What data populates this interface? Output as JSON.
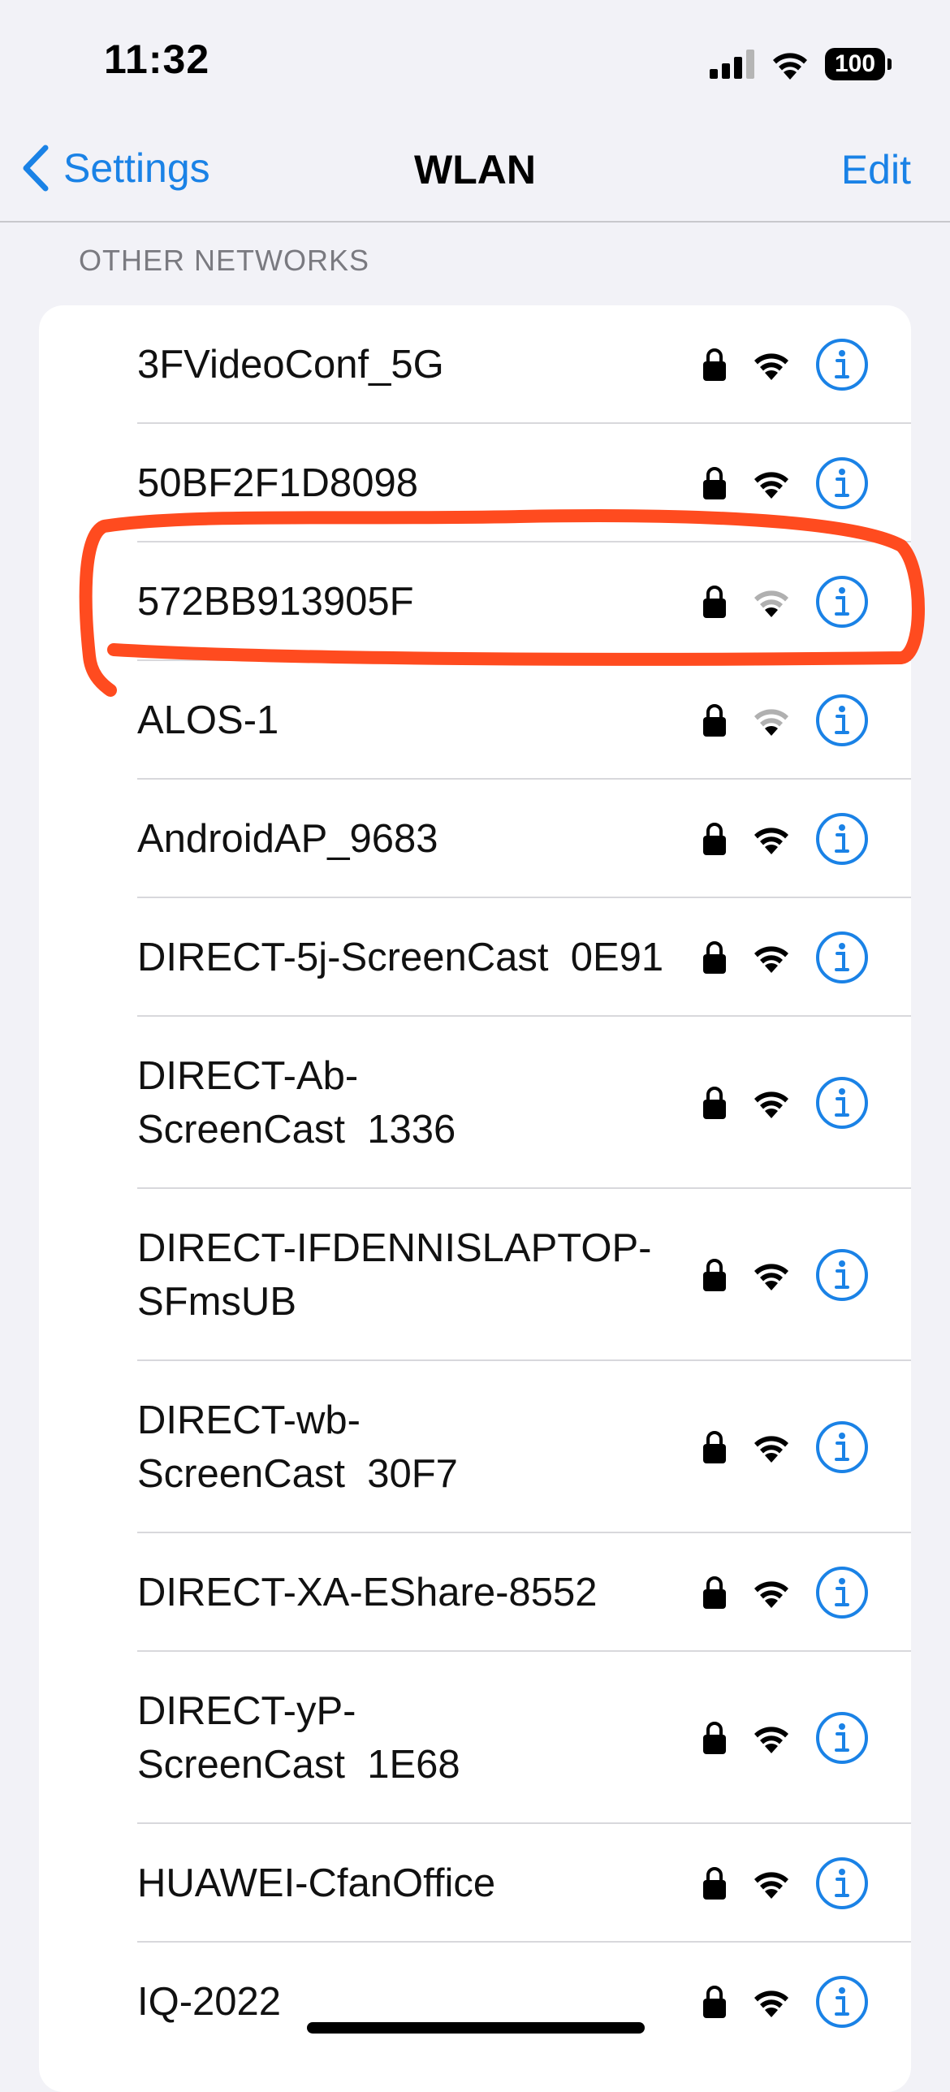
{
  "status_bar": {
    "time": "11:32",
    "battery": "100"
  },
  "nav": {
    "back_label": "Settings",
    "title": "WLAN",
    "edit_label": "Edit"
  },
  "section": {
    "header": "OTHER NETWORKS"
  },
  "networks": [
    {
      "line1": "3FVideoConf_5G",
      "line2": "",
      "signal": "full"
    },
    {
      "line1": "50BF2F1D8098",
      "line2": "",
      "signal": "full"
    },
    {
      "line1": "572BB913905F",
      "line2": "",
      "signal": "weak"
    },
    {
      "line1": "ALOS-1",
      "line2": "",
      "signal": "weak"
    },
    {
      "line1": "AndroidAP_9683",
      "line2": "",
      "signal": "full"
    },
    {
      "line1": "DIRECT-5j-ScreenCast  0E91",
      "line2": "",
      "signal": "full"
    },
    {
      "line1": "DIRECT-Ab-",
      "line2": "ScreenCast  1336",
      "signal": "full"
    },
    {
      "line1": "DIRECT-IFDENNISLAPTOP-",
      "line2": "SFmsUB",
      "signal": "full"
    },
    {
      "line1": "DIRECT-wb-",
      "line2": "ScreenCast  30F7",
      "signal": "full"
    },
    {
      "line1": "DIRECT-XA-EShare-8552",
      "line2": "",
      "signal": "full"
    },
    {
      "line1": "DIRECT-yP-",
      "line2": "ScreenCast  1E68",
      "signal": "full"
    },
    {
      "line1": "HUAWEI-CfanOffice",
      "line2": "",
      "signal": "full"
    },
    {
      "line1": "IQ-2022",
      "line2": "",
      "signal": "full"
    }
  ],
  "colors": {
    "accent": "#1a82e6",
    "annotation": "#ff4b1f"
  }
}
